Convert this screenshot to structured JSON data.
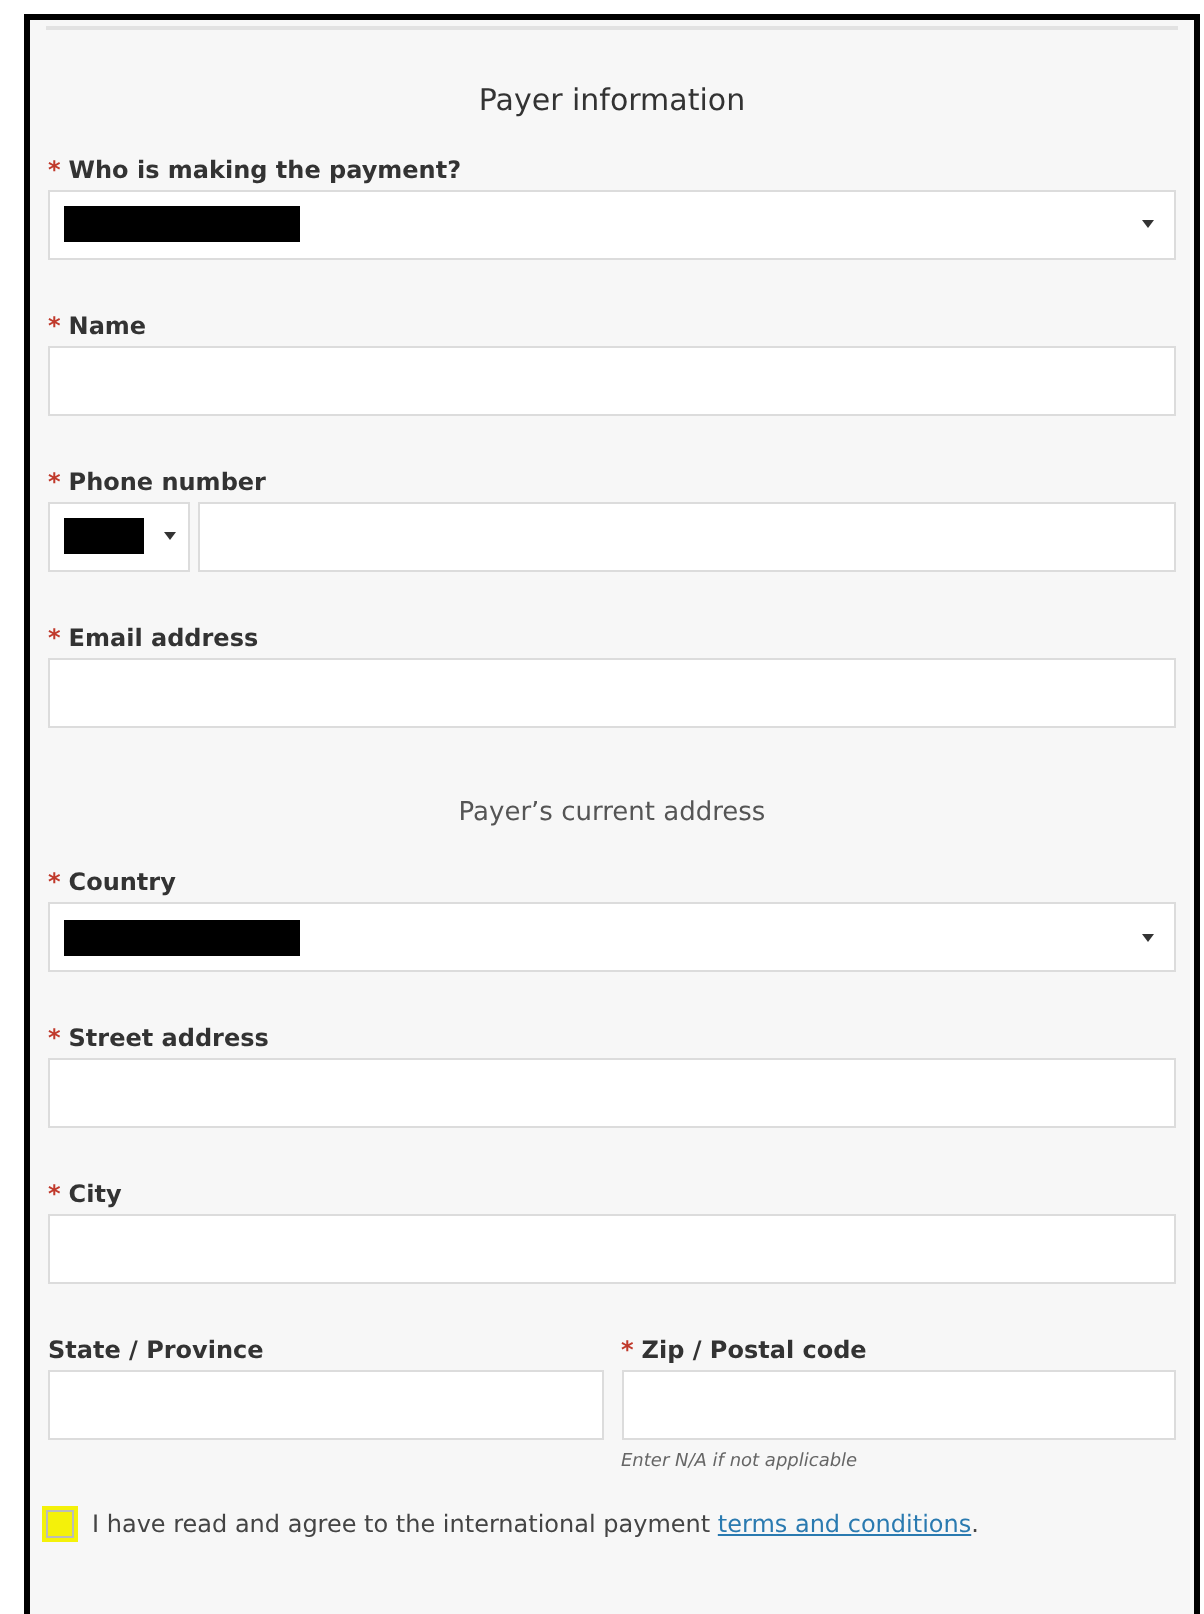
{
  "title": "Payer information",
  "sections": [
    {
      "fields": [
        {
          "kind": "select",
          "label": "Who is making the payment?",
          "marker": "*",
          "redacted": true
        },
        {
          "kind": "text",
          "label": "Name",
          "marker": "*"
        },
        {
          "kind": "phone",
          "label": "Phone number",
          "marker": "*",
          "redacted": true
        },
        {
          "kind": "text",
          "label": "Email address",
          "marker": "*"
        }
      ]
    },
    {
      "heading": "Payer’s current address",
      "fields": [
        {
          "kind": "select",
          "label": "Country",
          "marker": "*",
          "redacted": true
        },
        {
          "kind": "text",
          "label": "Street address",
          "marker": "*"
        },
        {
          "kind": "text",
          "label": "City",
          "marker": "*"
        },
        {
          "kind": "pair",
          "items": [
            {
              "label": "State / Province"
            },
            {
              "label": "Zip / Postal code",
              "marker": "*",
              "hint": "Enter N/A if not applicable"
            }
          ]
        }
      ]
    }
  ],
  "agreement": {
    "text": "I have read and agree to the international payment",
    "link": "terms and conditions",
    "after": ".",
    "checked": false,
    "highlighted": true
  }
}
